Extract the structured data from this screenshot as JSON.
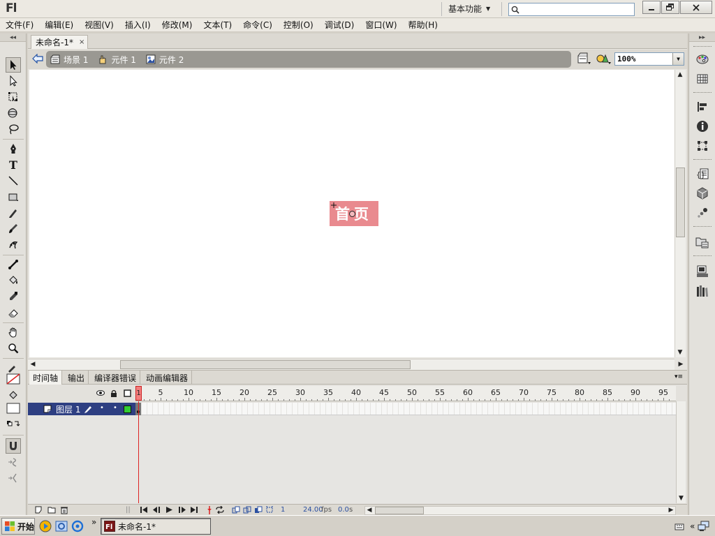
{
  "app": {
    "logo": "Fl",
    "workspace": "基本功能",
    "search_placeholder": ""
  },
  "menu": [
    "文件(F)",
    "编辑(E)",
    "视图(V)",
    "插入(I)",
    "修改(M)",
    "文本(T)",
    "命令(C)",
    "控制(O)",
    "调试(D)",
    "窗口(W)",
    "帮助(H)"
  ],
  "document": {
    "tab_title": "未命名-1*",
    "tab_close": "×",
    "breadcrumbs": [
      "场景 1",
      "元件 1",
      "元件 2"
    ],
    "zoom": "100%"
  },
  "stage": {
    "symbol_text": "首页",
    "symbol_color": "#e98a8f",
    "background": "#ffffff"
  },
  "timeline": {
    "tabs": [
      "时间轴",
      "输出",
      "编译器错误",
      "动画编辑器"
    ],
    "ruler_labels": [
      "1",
      "5",
      "10",
      "15",
      "20",
      "25",
      "30",
      "35",
      "40",
      "45",
      "50",
      "55",
      "60",
      "65",
      "70",
      "75",
      "80",
      "85",
      "90",
      "95"
    ],
    "layer_name": "图层 1",
    "current_frame": "1",
    "fps": "24.00",
    "fps_unit": "fps",
    "elapsed": "0.0",
    "elapsed_unit": "s",
    "outline_color": "#33cc33"
  },
  "taskbar": {
    "start_label": "开始",
    "task_label": "未命名-1*",
    "more": "»"
  },
  "icons": {
    "tools": [
      "selection-icon",
      "subselection-icon",
      "free-transform-icon",
      "3d-rotation-icon",
      "lasso-icon",
      "pen-icon",
      "text-icon",
      "line-icon",
      "rectangle-icon",
      "pencil-icon",
      "brush-icon",
      "deco-icon",
      "bone-icon",
      "paint-bucket-icon",
      "eyedropper-icon",
      "eraser-icon",
      "hand-icon",
      "zoom-icon"
    ],
    "right_panel": [
      "color-icon",
      "swatches-icon",
      "align-icon",
      "info-icon",
      "transform-icon",
      "actions-icon",
      "components-icon",
      "motion-presets-icon",
      "library-icon",
      "project-icon",
      "library-books-icon"
    ]
  }
}
